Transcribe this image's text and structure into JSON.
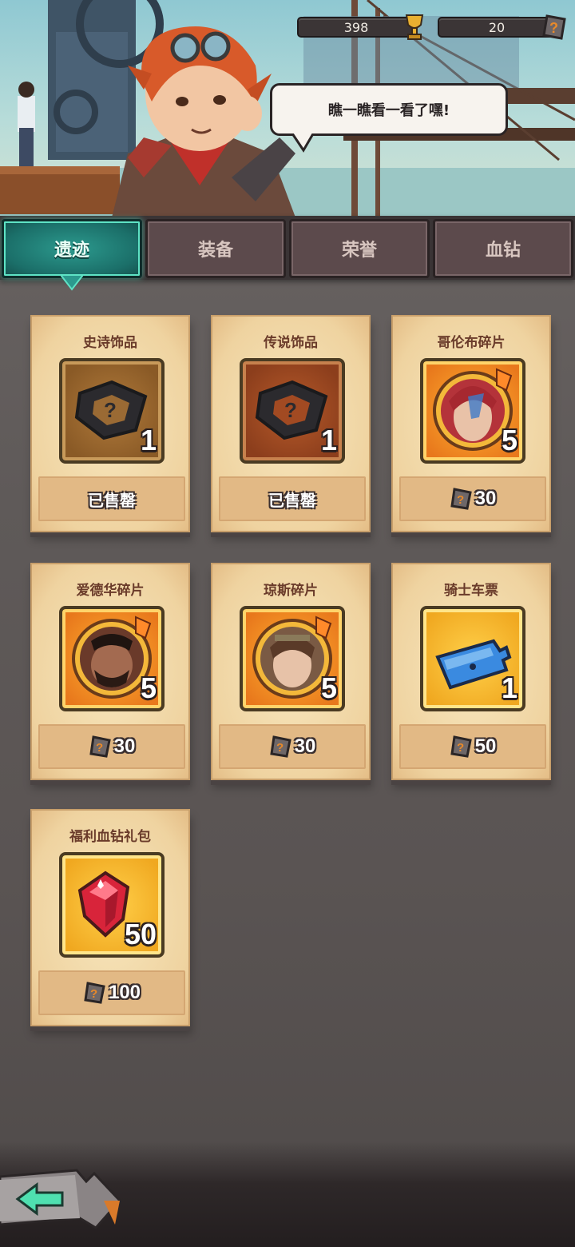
{
  "header": {
    "trophy_count": "398",
    "crystal_count": "20",
    "speech": "瞧一瞧看一看了嘿!"
  },
  "tabs": [
    {
      "label": "遗迹",
      "active": true
    },
    {
      "label": "装备",
      "active": false
    },
    {
      "label": "荣誉",
      "active": false
    },
    {
      "label": "血钻",
      "active": false
    }
  ],
  "items": [
    {
      "title": "史诗饰品",
      "qty": "1",
      "status": "已售罄",
      "icon": "mystery-ring-icon"
    },
    {
      "title": "传说饰品",
      "qty": "1",
      "status": "已售罄",
      "icon": "mystery-ring-icon"
    },
    {
      "title": "哥伦布碎片",
      "qty": "5",
      "price": "30",
      "icon": "hero-portrait-columbus"
    },
    {
      "title": "爱德华碎片",
      "qty": "5",
      "price": "30",
      "icon": "hero-portrait-edward"
    },
    {
      "title": "琼斯碎片",
      "qty": "5",
      "price": "30",
      "icon": "hero-portrait-jones"
    },
    {
      "title": "骑士车票",
      "qty": "1",
      "price": "50",
      "icon": "ticket-icon"
    },
    {
      "title": "福利血钻礼包",
      "qty": "50",
      "price": "100",
      "icon": "ruby-gem-icon"
    }
  ],
  "colors": {
    "active_tab": "#1b6f69",
    "card_bg": "#f0d9a8",
    "title_text": "#6a3b2a"
  }
}
